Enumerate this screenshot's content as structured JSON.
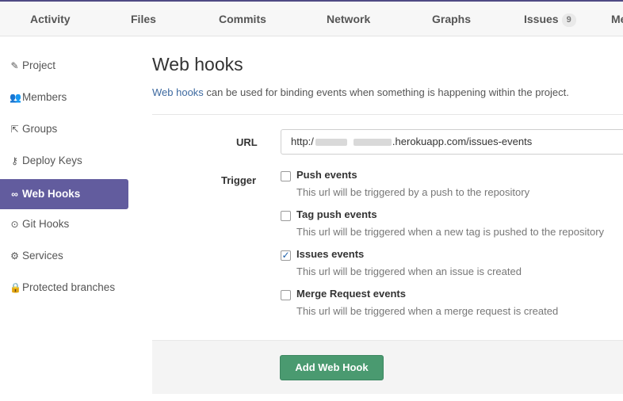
{
  "topnav": {
    "tabs": [
      {
        "label": "Activity"
      },
      {
        "label": "Files"
      },
      {
        "label": "Commits"
      },
      {
        "label": "Network"
      },
      {
        "label": "Graphs"
      },
      {
        "label": "Issues",
        "badge": "9"
      },
      {
        "label": "Me"
      }
    ]
  },
  "sidebar": {
    "items": [
      {
        "label": "Project",
        "icon": "edit-icon",
        "glyph": "✎"
      },
      {
        "label": "Members",
        "icon": "users-icon",
        "glyph": "👥"
      },
      {
        "label": "Groups",
        "icon": "external-link-icon",
        "glyph": "⇱"
      },
      {
        "label": "Deploy Keys",
        "icon": "key-icon",
        "glyph": "⚷"
      },
      {
        "label": "Web Hooks",
        "icon": "link-icon",
        "glyph": "∞",
        "active": true
      },
      {
        "label": "Git Hooks",
        "icon": "circle-arrow-up-icon",
        "glyph": "⊙"
      },
      {
        "label": "Services",
        "icon": "cogs-icon",
        "glyph": "⚙"
      },
      {
        "label": "Protected branches",
        "icon": "lock-icon",
        "glyph": "🔒"
      }
    ]
  },
  "main": {
    "title": "Web hooks",
    "description_link": "Web hooks",
    "description_rest": " can be used for binding events when something is happening within the project.",
    "url_label": "URL",
    "url_prefix": "http:/",
    "url_suffix": ".herokuapp.com/issues-events",
    "trigger_label": "Trigger",
    "triggers": [
      {
        "title": "Push events",
        "help": "This url will be triggered by a push to the repository",
        "checked": false
      },
      {
        "title": "Tag push events",
        "help": "This url will be triggered when a new tag is pushed to the repository",
        "checked": false
      },
      {
        "title": "Issues events",
        "help": "This url will be triggered when an issue is created",
        "checked": true
      },
      {
        "title": "Merge Request events",
        "help": "This url will be triggered when a merge request is created",
        "checked": false
      }
    ],
    "submit_label": "Add Web Hook"
  },
  "colors": {
    "accent": "#625c9e",
    "button": "#4a9a70",
    "link": "#3e6aa0"
  }
}
